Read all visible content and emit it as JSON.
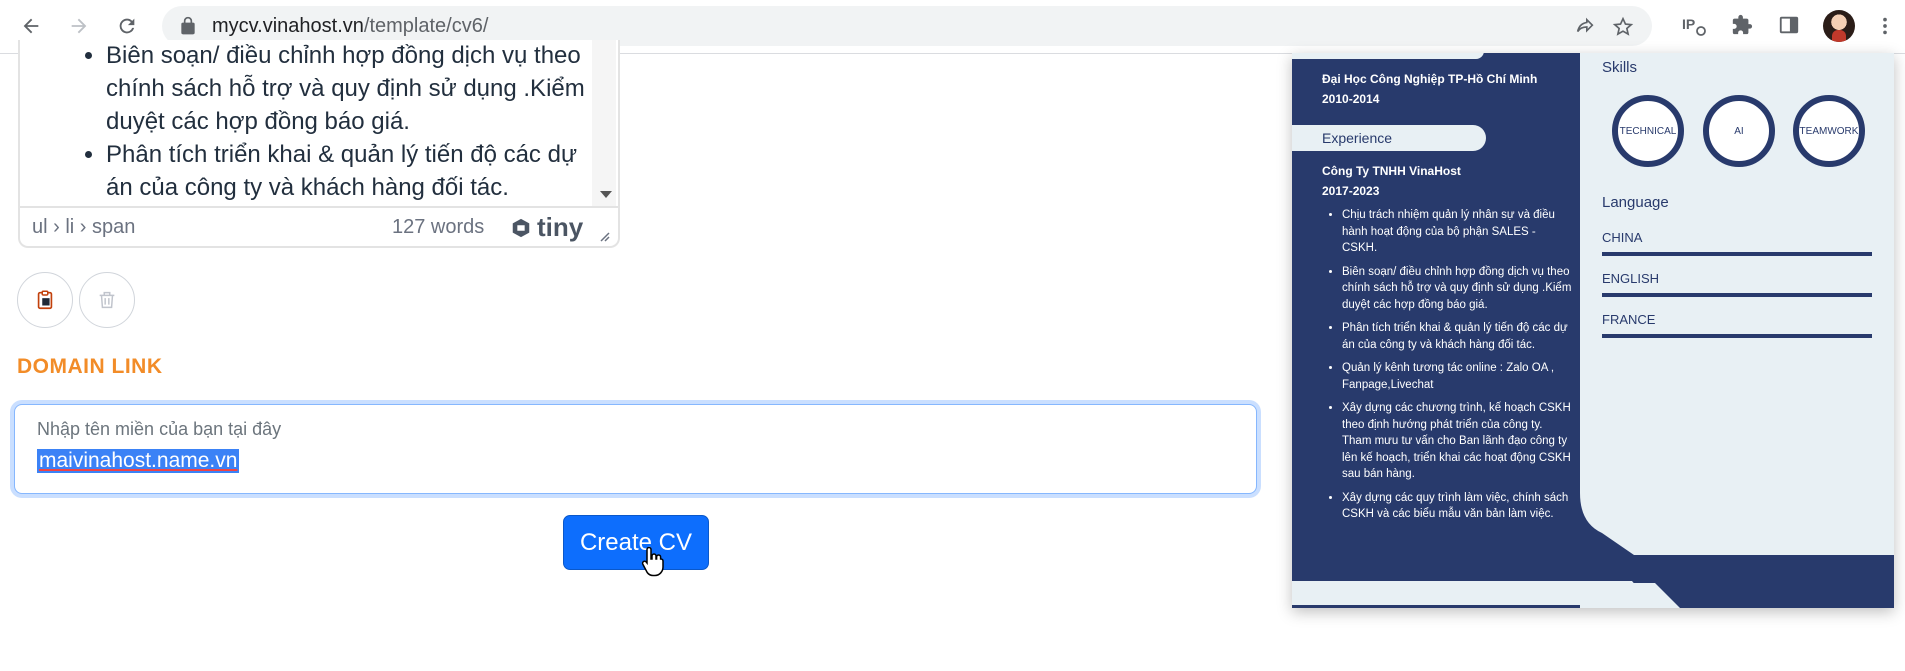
{
  "browser": {
    "url_host": "mycv.vinahost.vn",
    "url_path": "/template/cv6/"
  },
  "editor": {
    "bullets": [
      "Biên soạn/ điều chỉnh hợp đồng dịch vụ theo chính sách hỗ trợ và quy định sử dụng .Kiểm duyệt các hợp đồng báo giá.",
      "Phân tích triển khai & quản lý tiến độ các dự án của công ty và khách hàng đối tác."
    ],
    "status_path": "ul › li › span",
    "word_count": "127 words",
    "brand": "tiny"
  },
  "domain": {
    "heading": "DOMAIN LINK",
    "placeholder": "Nhập tên miền của bạn tại đây",
    "value": "maivinahost.name.vn"
  },
  "create_button": "Create CV",
  "cv": {
    "education_school": "Đại Học Công Nghiệp TP-Hồ Chí Minh",
    "education_years": "2010-2014",
    "experience_title": "Experience",
    "company": "Công Ty TNHH VinaHost",
    "company_years": "2017-2023",
    "duties": [
      "Chịu trách nhiệm quản lý nhân sự và điều hành hoạt động của bộ phận SALES - CSKH.",
      "Biên soạn/ điều chỉnh hợp đồng dịch vụ theo chính sách hỗ trợ và quy định sử dụng .Kiểm duyệt các hợp đồng báo giá.",
      "Phân tích triển khai & quản lý tiến độ các dự án của công ty và khách hàng đối tác.",
      "Quản lý kênh tương tác online : Zalo OA , Fanpage,Livechat",
      "Xây dựng các chương trình, kế hoạch CSKH theo định hướng phát triển của công ty. Tham mưu tư vấn cho Ban lãnh đạo công ty lên kế hoạch, triển khai các hoạt động CSKH sau bán hàng.",
      "Xây dựng các quy trình làm việc, chính sách CSKH và các biểu mẫu văn bản làm việc."
    ],
    "skills_title": "Skills",
    "skills": [
      "TECHNICAL",
      "AI",
      "TEAMWORK"
    ],
    "language_title": "Language",
    "languages": [
      "CHINA",
      "ENGLISH",
      "FRANCE"
    ]
  },
  "colors": {
    "cv_navy": "#283a6c",
    "cv_light": "#e8f0f4",
    "accent_orange": "#f28c28",
    "primary_blue": "#0d6efd"
  }
}
